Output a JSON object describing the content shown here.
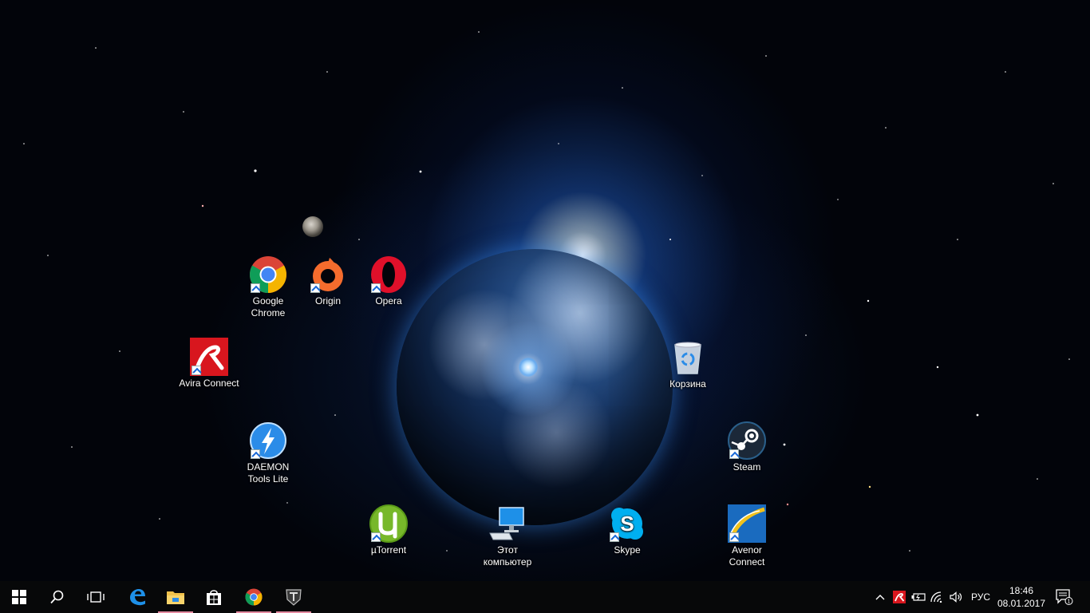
{
  "desktop": {
    "icons": {
      "chrome": "Google Chrome",
      "origin": "Origin",
      "opera": "Opera",
      "avira": "Avira Connect",
      "daemon": "DAEMON Tools Lite",
      "recycle": "Корзина",
      "steam": "Steam",
      "utorrent": "µTorrent",
      "computer": "Этот компьютер",
      "skype": "Skype",
      "avenor": "Avenor Connect"
    },
    "icon_names": {
      "chrome": "chrome-icon",
      "origin": "origin-icon",
      "opera": "opera-icon",
      "avira": "avira-icon",
      "daemon": "daemon-tools-icon",
      "recycle": "recycle-bin-icon",
      "steam": "steam-icon",
      "utorrent": "utorrent-icon",
      "computer": "this-pc-icon",
      "skype": "skype-icon",
      "avenor": "avenor-icon"
    }
  },
  "taskbar": {
    "buttons": [
      "start-icon",
      "search-icon",
      "task-view-icon",
      "edge-icon",
      "file-explorer-icon",
      "store-icon",
      "chrome-icon",
      "world-of-tanks-icon"
    ],
    "active_color": "#e48aa0"
  },
  "tray": {
    "language": "РУС",
    "time": "18:46",
    "date": "08.01.2017",
    "notification_count": "1"
  }
}
